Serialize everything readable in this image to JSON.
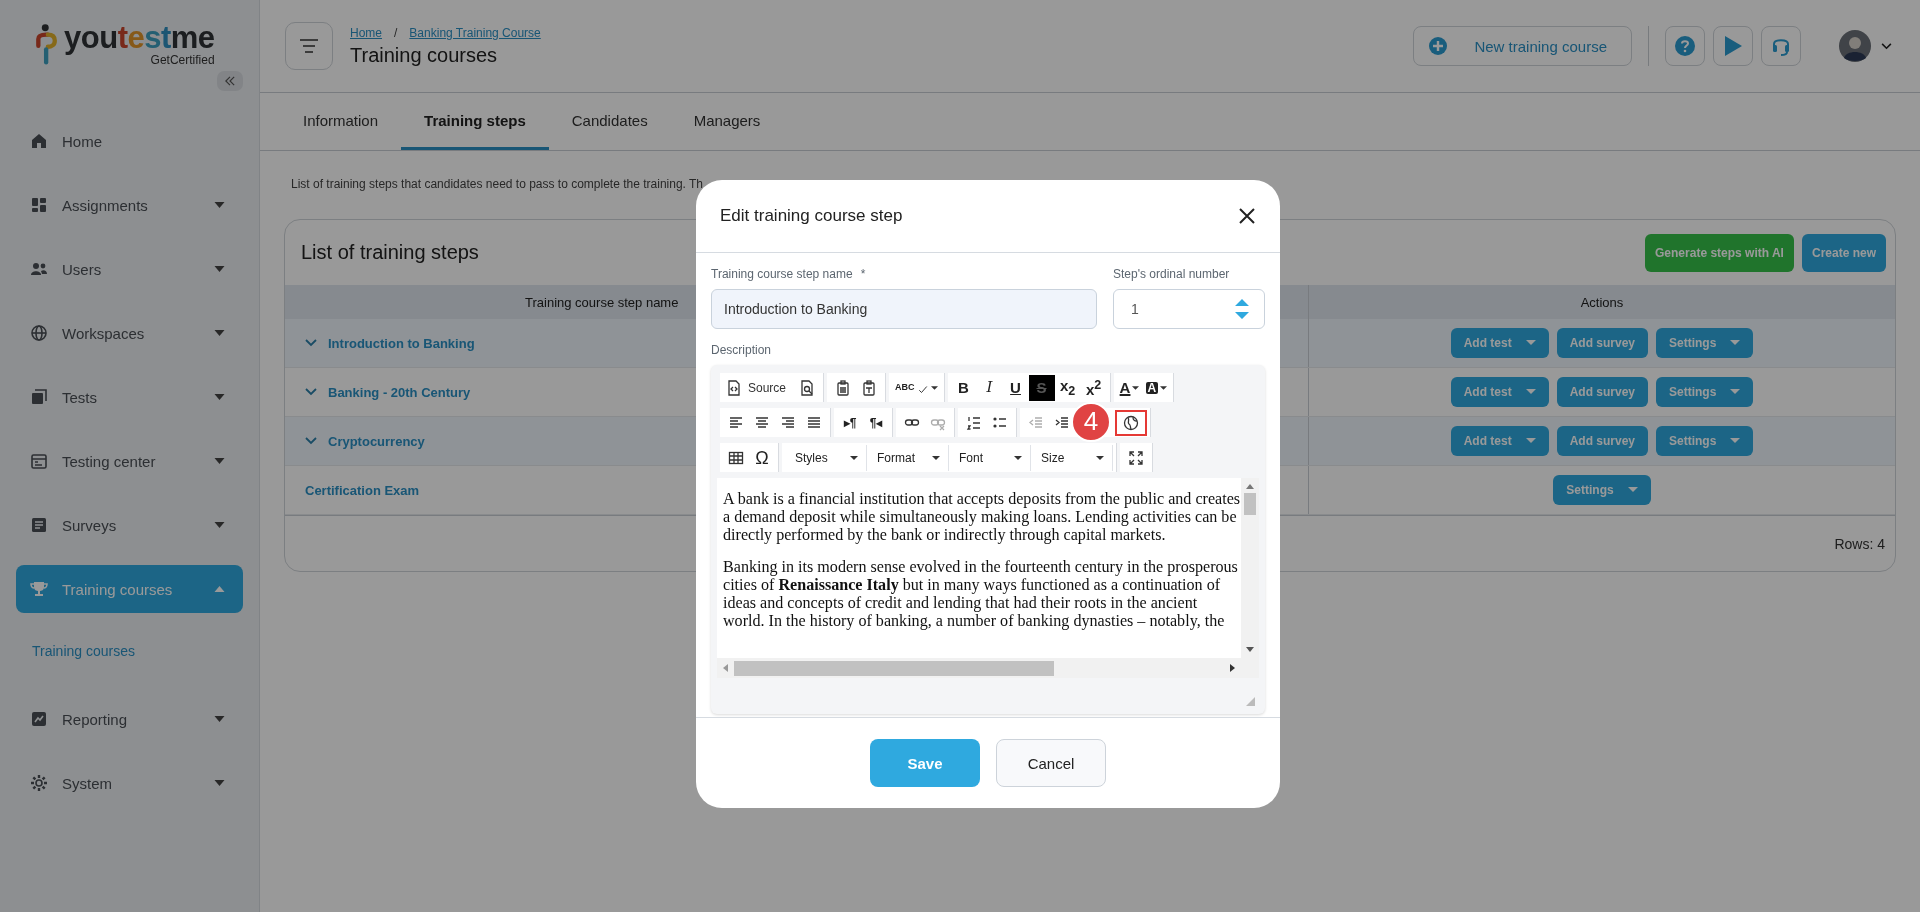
{
  "sidebar": {
    "logo": {
      "name": "youtestme",
      "tagline": "GetCertified"
    },
    "items": [
      {
        "label": "Home",
        "kind": "link",
        "selected": false
      },
      {
        "label": "Assignments",
        "kind": "group",
        "expanded": false,
        "selected": false
      },
      {
        "label": "Users",
        "kind": "group",
        "expanded": false,
        "selected": false
      },
      {
        "label": "Workspaces",
        "kind": "group",
        "expanded": false,
        "selected": false
      },
      {
        "label": "Tests",
        "kind": "group",
        "expanded": false,
        "selected": false
      },
      {
        "label": "Testing center",
        "kind": "group",
        "expanded": false,
        "selected": false
      },
      {
        "label": "Surveys",
        "kind": "group",
        "expanded": false,
        "selected": false
      },
      {
        "label": "Training courses",
        "kind": "group",
        "expanded": true,
        "selected": true,
        "children": [
          {
            "label": "Training courses"
          }
        ]
      },
      {
        "label": "Reporting",
        "kind": "group",
        "expanded": false,
        "selected": false
      },
      {
        "label": "System",
        "kind": "group",
        "expanded": false,
        "selected": false
      }
    ]
  },
  "header": {
    "breadcrumbs": [
      "Home",
      "Banking Training Course"
    ],
    "separator": "/",
    "title": "Training courses",
    "new_button": "New training course"
  },
  "tabs": [
    {
      "label": "Information",
      "selected": false
    },
    {
      "label": "Training steps",
      "selected": true
    },
    {
      "label": "Candidates",
      "selected": false
    },
    {
      "label": "Managers",
      "selected": false
    }
  ],
  "description": "List of training steps that candidates need to pass to complete the training. Th",
  "card": {
    "title": "List of training steps",
    "buttons": [
      {
        "label": "Generate steps with AI",
        "kind": "ai"
      },
      {
        "label": "Create new",
        "kind": "primary"
      }
    ],
    "columns": [
      "Training course step name",
      "Actions"
    ],
    "rows": [
      {
        "name": "Introduction to Banking",
        "kind": "group",
        "expanded": false,
        "actions": [
          {
            "label": "Add test",
            "dropdown": true
          },
          {
            "label": "Add survey",
            "dropdown": false
          },
          {
            "label": "Settings",
            "dropdown": true
          }
        ]
      },
      {
        "name": "Banking - 20th Century",
        "kind": "group",
        "expanded": false,
        "actions": [
          {
            "label": "Add test",
            "dropdown": true
          },
          {
            "label": "Add survey",
            "dropdown": false
          },
          {
            "label": "Settings",
            "dropdown": true
          }
        ]
      },
      {
        "name": "Cryptocurrency",
        "kind": "group",
        "expanded": false,
        "actions": [
          {
            "label": "Add test",
            "dropdown": true
          },
          {
            "label": "Add survey",
            "dropdown": false
          },
          {
            "label": "Settings",
            "dropdown": true
          }
        ]
      },
      {
        "name": "Certification Exam",
        "kind": "item",
        "actions": [
          {
            "label": "Settings",
            "dropdown": true
          }
        ]
      }
    ],
    "footer": "Rows: 4"
  },
  "modal": {
    "title": "Edit training course step",
    "name_field": {
      "label": "Training course step name",
      "required": true,
      "required_mark": "*",
      "value": "Introduction to Banking"
    },
    "ordinal_field": {
      "label": "Step's ordinal number",
      "value": "1"
    },
    "description_label": "Description",
    "toolbar": [
      [
        [
          {
            "kind": "source",
            "label": "Source",
            "on": false,
            "disabled": false,
            "highlighted": false
          },
          {
            "kind": "preview",
            "on": false,
            "disabled": false,
            "highlighted": false
          }
        ],
        [
          {
            "kind": "paste",
            "on": false,
            "disabled": false,
            "highlighted": false
          },
          {
            "kind": "paste-text",
            "on": false,
            "disabled": false,
            "highlighted": false
          }
        ],
        [
          {
            "kind": "spellcheck",
            "glyph": "ABC",
            "on": false,
            "disabled": false,
            "highlighted": false
          }
        ],
        [
          {
            "kind": "bold",
            "glyph": "B",
            "on": false,
            "disabled": false,
            "highlighted": false
          },
          {
            "kind": "italic",
            "glyph": "I",
            "on": false,
            "disabled": false,
            "highlighted": false
          },
          {
            "kind": "underline",
            "glyph": "U",
            "on": false,
            "disabled": false,
            "highlighted": false
          },
          {
            "kind": "strike",
            "glyph": "S",
            "on": true,
            "disabled": false,
            "highlighted": false
          },
          {
            "kind": "subscript",
            "glyph": "x$_{2}$",
            "on": false,
            "disabled": false,
            "highlighted": false
          },
          {
            "kind": "superscript",
            "glyph": "x$^{2}$",
            "on": false,
            "disabled": false,
            "highlighted": false
          }
        ],
        [
          {
            "kind": "text-color",
            "glyph": "A",
            "on": false,
            "disabled": false,
            "highlighted": false
          },
          {
            "kind": "background-color",
            "glyph": "A",
            "on": false,
            "disabled": false,
            "highlighted": false
          }
        ]
      ],
      [
        [
          {
            "kind": "align-left",
            "on": false,
            "disabled": false,
            "highlighted": false
          },
          {
            "kind": "align-center",
            "on": false,
            "disabled": false,
            "highlighted": false
          },
          {
            "kind": "align-right",
            "on": false,
            "disabled": false,
            "highlighted": false
          },
          {
            "kind": "justify",
            "on": false,
            "disabled": false,
            "highlighted": false
          }
        ],
        [
          {
            "kind": "ltr",
            "glyph": "▸¶",
            "on": false,
            "disabled": false,
            "highlighted": false
          },
          {
            "kind": "rtl",
            "glyph": "¶◂",
            "on": false,
            "disabled": false,
            "highlighted": false
          }
        ],
        [
          {
            "kind": "link",
            "on": false,
            "disabled": false,
            "highlighted": false
          },
          {
            "kind": "unlink",
            "on": false,
            "disabled": true,
            "highlighted": false
          }
        ],
        [
          {
            "kind": "numbered-list",
            "on": false,
            "disabled": false,
            "highlighted": false
          },
          {
            "kind": "bulleted-list",
            "on": false,
            "disabled": false,
            "highlighted": false
          }
        ],
        [
          {
            "kind": "outdent",
            "on": false,
            "disabled": true,
            "highlighted": false
          },
          {
            "kind": "indent",
            "on": false,
            "disabled": false,
            "highlighted": false
          }
        ],
        [
          {
            "kind": "globe",
            "on": false,
            "disabled": false,
            "highlighted": true
          }
        ]
      ],
      [
        [
          {
            "kind": "table",
            "on": false,
            "disabled": false,
            "highlighted": false
          },
          {
            "kind": "special-char",
            "glyph": "Ω",
            "on": false,
            "disabled": false,
            "highlighted": false
          }
        ],
        [
          {
            "kind": "dropdown",
            "label": "Styles",
            "on": false,
            "disabled": false,
            "highlighted": false
          },
          {
            "kind": "dropdown",
            "label": "Format",
            "on": false,
            "disabled": false,
            "highlighted": false
          },
          {
            "kind": "dropdown",
            "label": "Font",
            "on": false,
            "disabled": false,
            "highlighted": false
          },
          {
            "kind": "dropdown",
            "label": "Size",
            "on": false,
            "disabled": false,
            "highlighted": false
          }
        ],
        [
          {
            "kind": "maximize",
            "on": false,
            "disabled": false,
            "highlighted": false
          }
        ]
      ]
    ],
    "step_badge": "4",
    "content": [
      "A bank is a financial institution that accepts deposits from the public and creates a demand deposit while simultaneously making loans. Lending activities can be directly performed by the bank or indirectly through capital markets.",
      "Banking in its modern sense evolved in the fourteenth century in the prosperous cities of **Renaissance Italy** but in many ways functioned as a continuation of ideas and concepts of credit and lending that had their roots in the ancient world. In the history of banking, a number of banking dynasties – notably, the"
    ],
    "buttons": [
      {
        "label": "Save",
        "kind": "primary"
      },
      {
        "label": "Cancel",
        "kind": "secondary"
      }
    ]
  }
}
